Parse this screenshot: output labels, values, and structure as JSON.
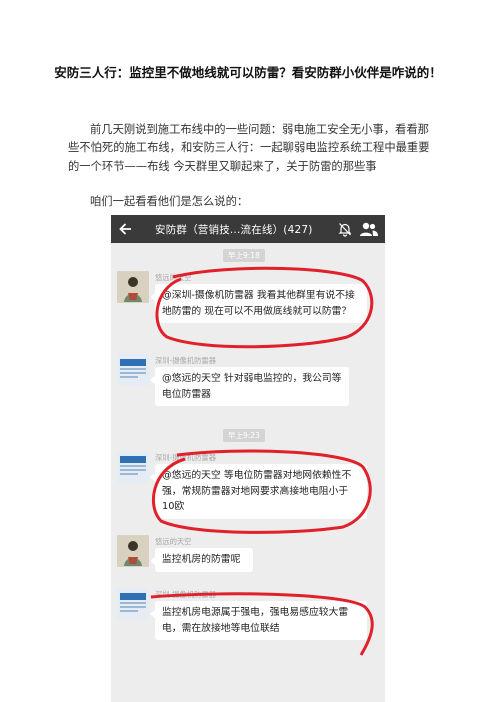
{
  "article": {
    "title": "安防三人行：监控里不做地线就可以防雷？看安防群小伙伴是咋说的！",
    "paragraph_1": "前几天刚说到施工布线中的一些问题：弱电施工安全无小事，看看那些不怕死的施工布线，和安防三人行：一起聊弱电监控系统工程中最重要的一个环节——布线 今天群里又聊起来了，关于防雷的那些事",
    "paragraph_2": "咱们一起看看他们是怎么说的："
  },
  "chat": {
    "header_title": "安防群（营销技...流在线）(427)",
    "icons": {
      "back": "back-arrow-icon",
      "mute": "mute-bell-icon",
      "members": "group-members-icon"
    },
    "messages": [
      {
        "time": "早上9:18"
      },
      {
        "sender": "悠远的天空",
        "avatar": "person-avatar",
        "text": "@深圳-摄像机防雷器 我看其他群里有说不接地防雷的  现在可以不用做底线就可以防雷？"
      },
      {
        "sender": "深圳-摄像机防雷器",
        "avatar": "logo-avatar",
        "text": "@悠远的天空 针对弱电监控的，我公司等电位防雷器"
      },
      {
        "time": "早上9:23"
      },
      {
        "sender": "深圳-摄像机防雷器",
        "avatar": "logo-avatar",
        "text": "@悠远的天空 等电位防雷器对地网依赖性不强，常规防雷器对地网要求高接地电阻小于10欧"
      },
      {
        "sender": "悠远的天空",
        "avatar": "person-avatar",
        "text": "监控机房的防雷呢"
      },
      {
        "sender": "深圳-摄像机防雷器",
        "avatar": "logo-avatar",
        "text": "监控机房电源属于强电，强电易感应较大雷电，需在放接地等电位联结"
      }
    ],
    "colors": {
      "header_bg": "#3a3a3a",
      "chat_bg": "#ededed",
      "annotation": "#e0202a"
    }
  }
}
